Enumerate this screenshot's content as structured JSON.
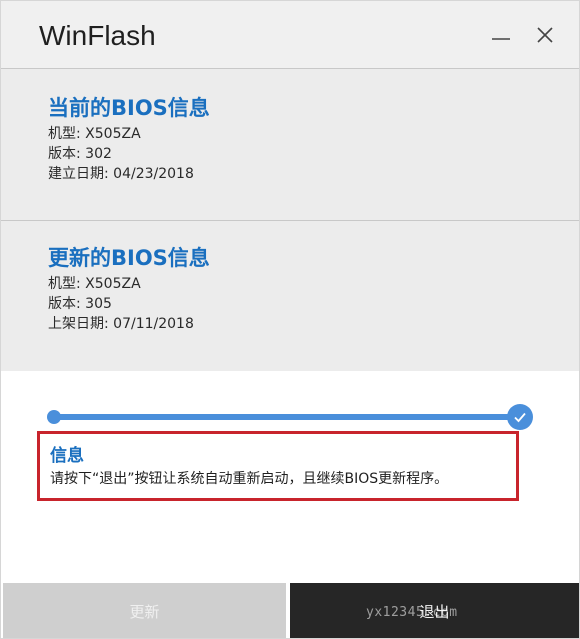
{
  "window": {
    "title": "WinFlash"
  },
  "current_bios": {
    "heading": "当前的BIOS信息",
    "model": "机型: X505ZA",
    "version": "版本: 302",
    "date": "建立日期: 04/23/2018"
  },
  "new_bios": {
    "heading": "更新的BIOS信息",
    "model": "机型: X505ZA",
    "version": "版本: 305",
    "date": "上架日期: 07/11/2018"
  },
  "progress": {
    "value": 1.0,
    "complete": true
  },
  "message": {
    "title": "信息",
    "text": "请按下“退出”按钮让系统自动重新启动，且继续BIOS更新程序。"
  },
  "buttons": {
    "update_label": "更新",
    "exit_label": "退出"
  },
  "watermark": {
    "text": "yx12345.com"
  },
  "colors": {
    "accent": "#4a8fdb",
    "heading_blue": "#1a6fbf",
    "highlight_border": "#c8242c",
    "exit_button": "#262626",
    "update_button_disabled": "#cfcfcf"
  },
  "icons": {
    "minimize": "minimize-icon",
    "close": "close-icon",
    "progress_complete": "check-icon"
  }
}
